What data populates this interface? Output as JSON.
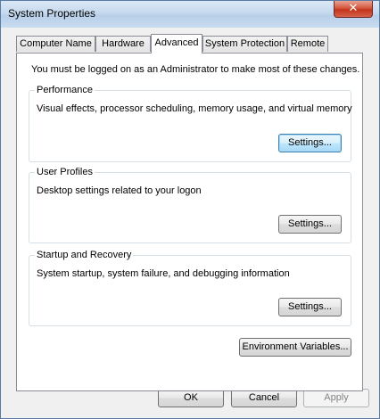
{
  "window": {
    "title": "System Properties",
    "close_glyph": "✕"
  },
  "tabs": [
    {
      "label": "Computer Name",
      "active": false
    },
    {
      "label": "Hardware",
      "active": false
    },
    {
      "label": "Advanced",
      "active": true
    },
    {
      "label": "System Protection",
      "active": false
    },
    {
      "label": "Remote",
      "active": false
    }
  ],
  "advanced": {
    "notice": "You must be logged on as an Administrator to make most of these changes.",
    "performance": {
      "title": "Performance",
      "description": "Visual effects, processor scheduling, memory usage, and virtual memory",
      "button": "Settings..."
    },
    "user_profiles": {
      "title": "User Profiles",
      "description": "Desktop settings related to your logon",
      "button": "Settings..."
    },
    "startup_recovery": {
      "title": "Startup and Recovery",
      "description": "System startup, system failure, and debugging information",
      "button": "Settings..."
    },
    "env_button": "Environment Variables..."
  },
  "footer": {
    "ok": "OK",
    "cancel": "Cancel",
    "apply": "Apply"
  }
}
